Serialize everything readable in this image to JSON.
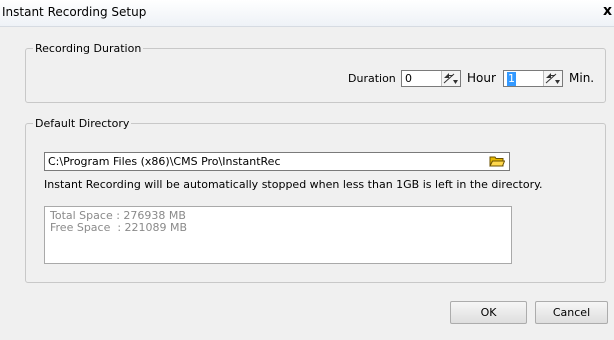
{
  "window": {
    "title": "Instant Recording Setup",
    "close_glyph": "x"
  },
  "recording_duration": {
    "legend": "Recording Duration",
    "duration_label": "Duration",
    "hour_value": "0",
    "hour_label": "Hour",
    "min_value": "1",
    "min_label": "Min."
  },
  "default_directory": {
    "legend": "Default Directory",
    "path": "C:\\Program Files (x86)\\CMS Pro\\InstantRec",
    "note": "Instant Recording will be automatically stopped when less than 1GB is left in the directory.",
    "total_space": "Total Space : 276938 MB",
    "free_space": "Free Space  : 221089 MB"
  },
  "buttons": {
    "ok": "OK",
    "cancel": "Cancel"
  },
  "icons": {
    "close": "close-icon",
    "spin": "spin-updown-icon",
    "folder": "folder-open-icon"
  },
  "colors": {
    "selection": "#3399ff",
    "folder": "#e6b800"
  }
}
